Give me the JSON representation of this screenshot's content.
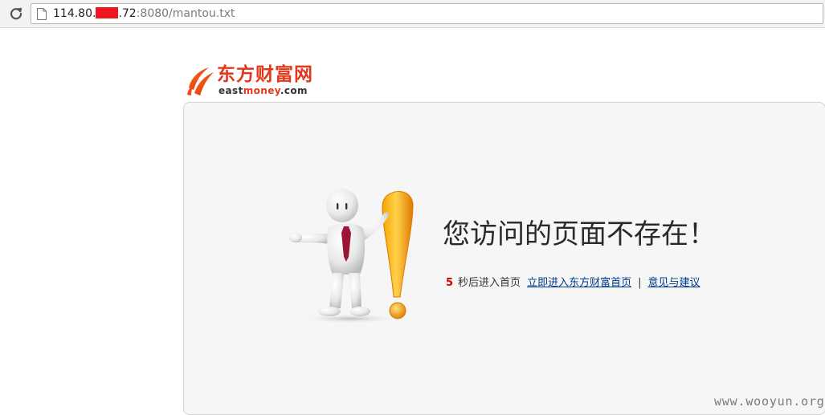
{
  "browser": {
    "url_host": "114.80.",
    "url_host_after": ".72",
    "url_path": ":8080/mantou.txt",
    "redaction_color": "#f0141e"
  },
  "logo": {
    "name_cn": "东方财富网",
    "domain_part1": "east",
    "domain_part2": "money",
    "domain_part3": ".com",
    "brand_color": "#e3361a"
  },
  "error": {
    "title": "您访问的页面不存在！",
    "countdown": "5",
    "redirect_text": "秒后进入首页",
    "home_link_label": "立即进入东方财富首页",
    "separator": "|",
    "feedback_link_label": "意见与建议"
  },
  "watermark": "www.wooyun.org",
  "icons": {
    "reload": "reload-icon",
    "page": "page-icon",
    "logo": "eastmoney-logo-mark",
    "illustration": "person-exclamation-illustration"
  }
}
